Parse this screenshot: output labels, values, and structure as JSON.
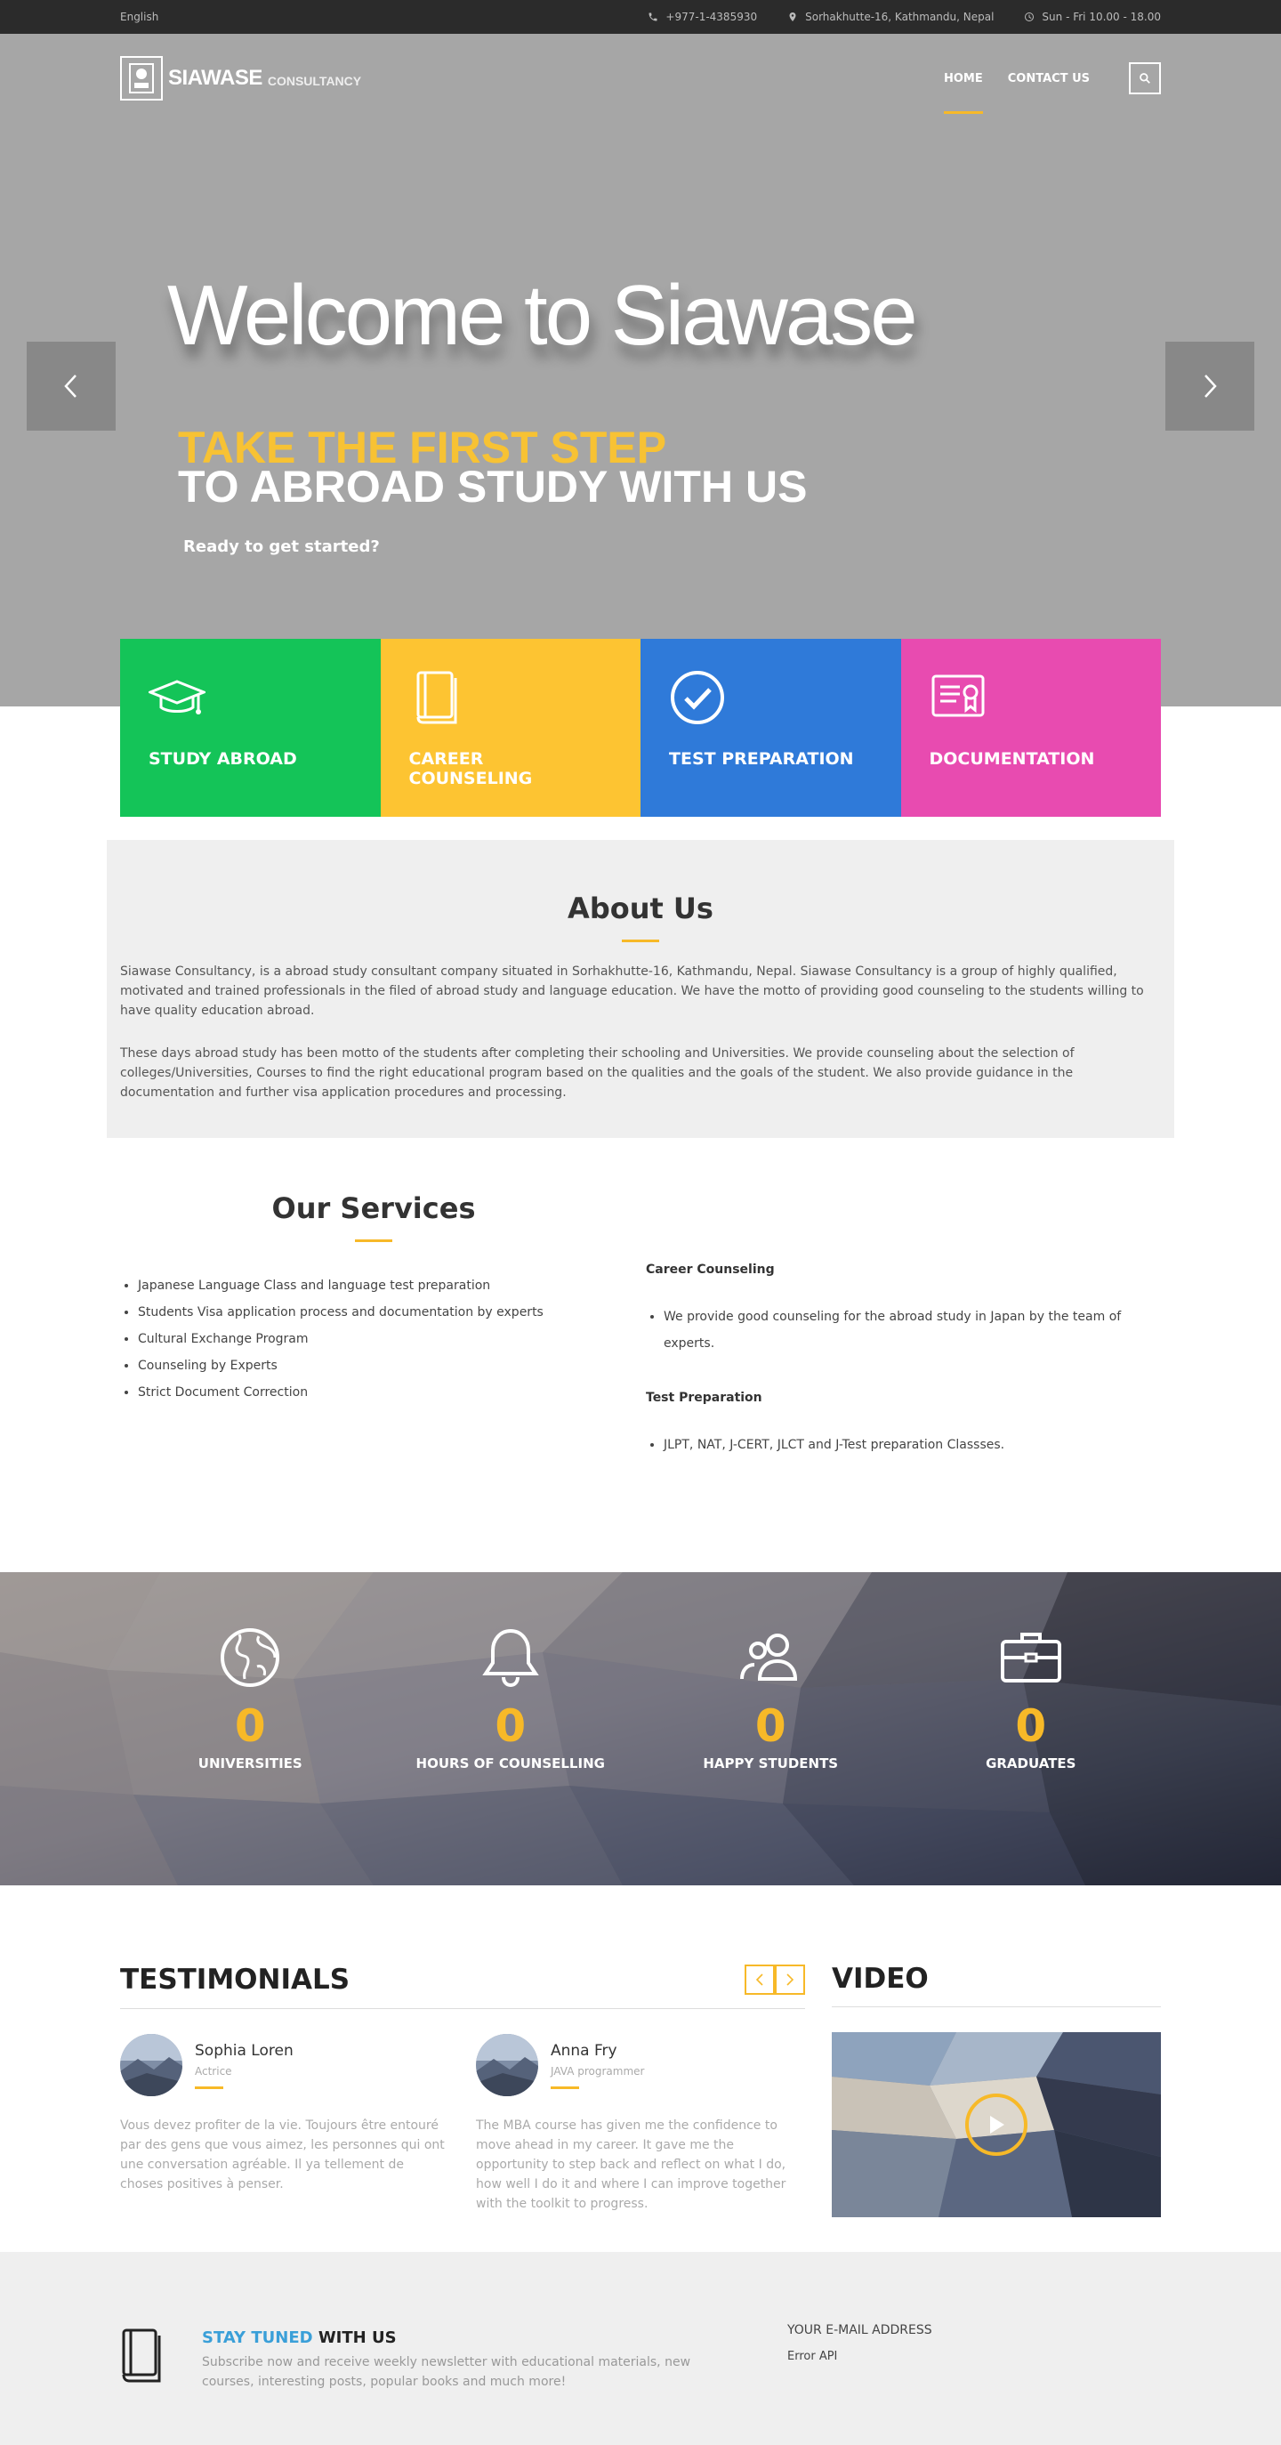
{
  "topbar": {
    "language": "English",
    "phone": "+977-1-4385930",
    "address": "Sorhakhutte-16, Kathmandu, Nepal",
    "hours": "Sun - Fri 10.00 - 18.00"
  },
  "header": {
    "logo_name": "SIAWASE",
    "logo_sub": "CONSULTANCY",
    "nav": [
      {
        "label": "HOME",
        "active": true
      },
      {
        "label": "CONTACT US",
        "active": false
      }
    ]
  },
  "hero": {
    "title": "Welcome to Siawase",
    "subtitle_line1": "TAKE THE FIRST STEP",
    "subtitle_line2": "TO ABROAD STUDY WITH US",
    "cta": "Ready to get started?"
  },
  "features": [
    {
      "label": "STUDY ABROAD",
      "color": "#14c458",
      "icon": "graduation-cap-icon"
    },
    {
      "label": "CAREER COUNSELING",
      "color": "#fdc432",
      "icon": "book-icon"
    },
    {
      "label": "TEST PREPARATION",
      "color": "#2f7ad9",
      "icon": "check-circle-icon"
    },
    {
      "label": "DOCUMENTATION",
      "color": "#e84bb0",
      "icon": "certificate-icon"
    }
  ],
  "about": {
    "title": "About Us",
    "p1": "Siawase Consultancy, is a abroad study consultant company situated in Sorhakhutte-16, Kathmandu, Nepal. Siawase Consultancy is a group of highly qualified, motivated and trained professionals in the filed of abroad study and language education. We have the motto of providing good counseling to the students willing to have quality education abroad.",
    "p2": "These days abroad study has been motto of the students after completing their schooling and Universities. We provide counseling about the selection of colleges/Universities, Courses to find the right educational program based on the qualities and the goals of the student. We also provide guidance in the documentation and further visa application procedures and processing."
  },
  "services": {
    "title": "Our Services",
    "list": [
      "Japanese Language Class and language test preparation",
      "Students Visa application process and documentation by experts",
      "Cultural Exchange Program",
      "Counseling by Experts",
      "Strict Document Correction"
    ],
    "career_title": "Career Counseling",
    "career_item": "We provide good counseling for the abroad study in Japan by the team of experts.",
    "test_title": "Test Preparation",
    "test_item": "JLPT, NAT, J-CERT, JLCT and J-Test preparation Classses."
  },
  "stats": [
    {
      "icon": "globe-icon",
      "value": "0",
      "label": "UNIVERSITIES"
    },
    {
      "icon": "bell-icon",
      "value": "0",
      "label": "HOURS OF COUNSELLING"
    },
    {
      "icon": "users-icon",
      "value": "0",
      "label": "HAPPY STUDENTS"
    },
    {
      "icon": "briefcase-icon",
      "value": "0",
      "label": "GRADUATES"
    }
  ],
  "testimonials": {
    "title": "TESTIMONIALS",
    "items": [
      {
        "name": "Sophia Loren",
        "role": "Actrice",
        "text": "Vous devez profiter de la vie. Toujours être entouré par des gens que vous aimez, les personnes qui ont une conversation agréable. Il ya tellement de choses positives à penser."
      },
      {
        "name": "Anna Fry",
        "role": "JAVA programmer",
        "text": "The MBA course has given me the confidence to move ahead in my career. It gave me the opportunity to step back and reflect on what I do, how well I do it and where I can improve together with the toolkit to progress."
      }
    ]
  },
  "video": {
    "title": "VIDEO"
  },
  "newsletter": {
    "title_highlight": "STAY TUNED",
    "title_rest": " WITH US",
    "description": "Subscribe now and receive weekly newsletter with educational materials, new courses, interesting posts, popular books and much more!",
    "email_label": "YOUR E-MAIL ADDRESS",
    "error": "Error API"
  },
  "colors": {
    "accent": "#f7b928",
    "link_blue": "#3a9fd8"
  }
}
